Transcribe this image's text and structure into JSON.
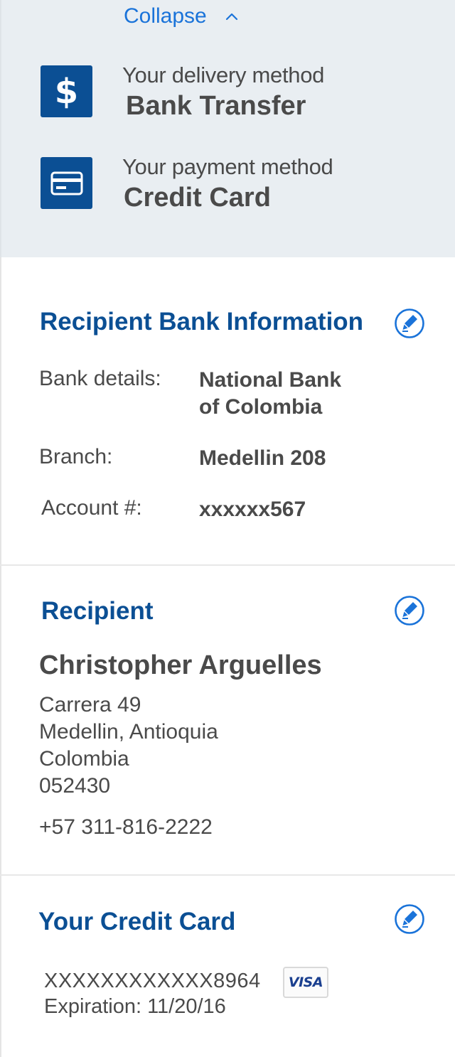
{
  "summary": {
    "collapse_label": "Collapse",
    "delivery": {
      "label": "Your delivery method",
      "value": "Bank Transfer",
      "icon": "dollar-icon",
      "icon_glyph": "$"
    },
    "payment": {
      "label": "Your payment method",
      "value": "Credit Card",
      "icon": "credit-card-icon"
    }
  },
  "bank_info": {
    "title": "Recipient Bank Information",
    "rows": [
      {
        "label": "Bank details:",
        "value_line1": "National Bank",
        "value_line2": "of Colombia"
      },
      {
        "label": "Branch:",
        "value": "Medellin 208"
      },
      {
        "label": "Account #:",
        "value": "xxxxxx567"
      }
    ]
  },
  "recipient": {
    "title": "Recipient",
    "name": "Christopher Arguelles",
    "address": [
      "Carrera 49",
      "Medellin, Antioquia",
      "Colombia",
      "052430"
    ],
    "phone": "+57 311-816-2222"
  },
  "credit_card": {
    "title": "Your Credit Card",
    "number": "XXXXXXXXXXXX8964",
    "expiration": "Expiration: 11/20/16",
    "brand": "VISA"
  },
  "colors": {
    "accent": "#0b4f94",
    "link": "#1a73d9",
    "summary_bg": "#e9eef2",
    "text": "#4a4a4a"
  }
}
